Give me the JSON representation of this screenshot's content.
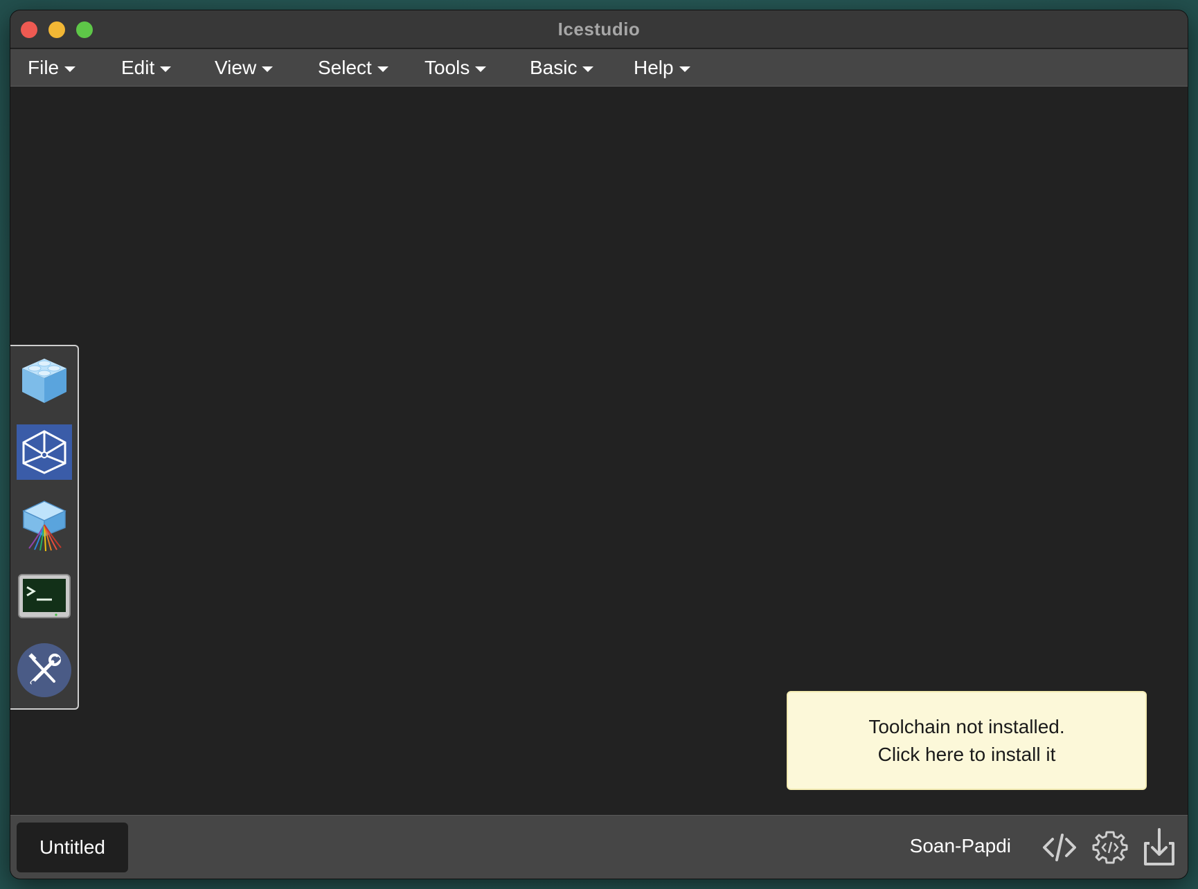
{
  "window": {
    "title": "Icestudio"
  },
  "menubar": {
    "items": [
      {
        "label": "File"
      },
      {
        "label": "Edit"
      },
      {
        "label": "View"
      },
      {
        "label": "Select"
      },
      {
        "label": "Tools"
      },
      {
        "label": "Basic"
      },
      {
        "label": "Help"
      }
    ]
  },
  "toolbox": {
    "items": [
      {
        "icon": "block-cube-icon"
      },
      {
        "icon": "wireframe-cube-icon"
      },
      {
        "icon": "fpga-wires-cube-icon"
      },
      {
        "icon": "terminal-icon"
      },
      {
        "icon": "wrench-screwdriver-icon"
      }
    ]
  },
  "toast": {
    "line1": "Toolchain not installed.",
    "line2": "Click here to install it"
  },
  "footer": {
    "file_name": "Untitled",
    "board_name": "Soan-Papdi",
    "icons": [
      "code-icon",
      "gear-code-icon",
      "upload-download-icon"
    ]
  },
  "colors": {
    "canvas": "#222222",
    "menubar": "#464646",
    "toast_bg": "#fcf8d9",
    "active_tool": "#3a5ca8"
  }
}
